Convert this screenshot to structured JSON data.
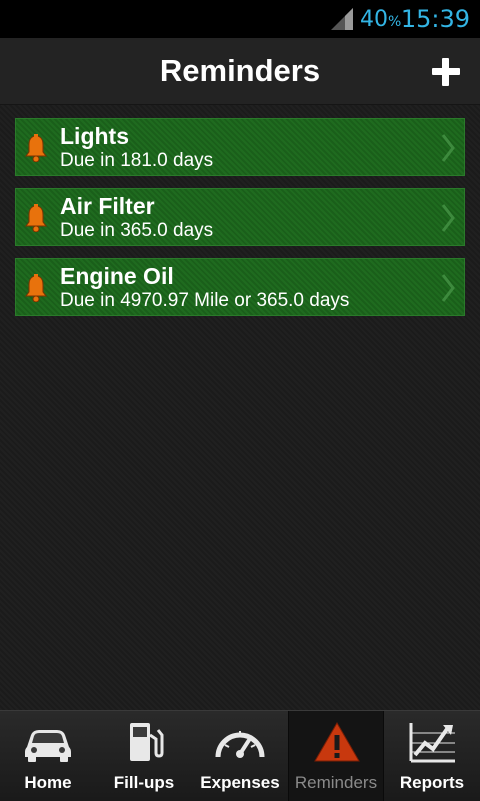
{
  "status_bar": {
    "battery_value": "40",
    "battery_unit": "%",
    "time": "15:39"
  },
  "header": {
    "title": "Reminders"
  },
  "reminders": [
    {
      "title": "Lights",
      "subtitle": "Due in 181.0 days"
    },
    {
      "title": "Air Filter",
      "subtitle": "Due in 365.0 days"
    },
    {
      "title": "Engine Oil",
      "subtitle": "Due in 4970.97 Mile or 365.0 days"
    }
  ],
  "nav": [
    {
      "label": "Home",
      "icon": "car-icon"
    },
    {
      "label": "Fill-ups",
      "icon": "fuel-pump-icon"
    },
    {
      "label": "Expenses",
      "icon": "speedometer-icon"
    },
    {
      "label": "Reminders",
      "icon": "warning-icon",
      "active": true
    },
    {
      "label": "Reports",
      "icon": "chart-icon"
    }
  ],
  "colors": {
    "accent": "#33b5e5",
    "item_green": "#1f6b1f",
    "bell_orange": "#e8720c",
    "warning_red": "#c8380e"
  }
}
